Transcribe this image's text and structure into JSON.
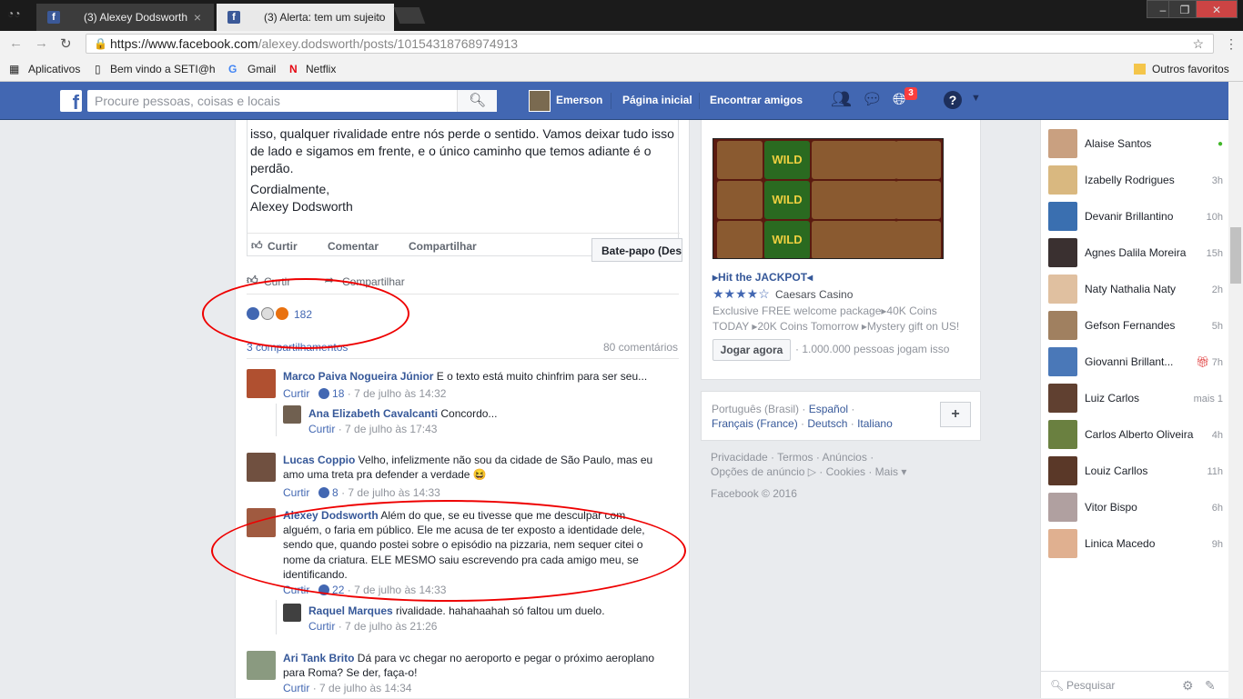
{
  "browser": {
    "tabs": [
      {
        "title": "(3) Alexey Dodsworth",
        "close": "×"
      },
      {
        "title": "(3) Alerta: tem um sujeito",
        "close": "×"
      }
    ],
    "url_host": "https://www.facebook.com",
    "url_path": "/alexey.dodsworth/posts/10154318768974913",
    "bookmarks": [
      "Aplicativos",
      "Bem vindo a SETI@ho",
      "Gmail",
      "Netflix"
    ],
    "other_bookmarks": "Outros favoritos"
  },
  "fb_header": {
    "logo": "f",
    "search_placeholder": "Procure pessoas, coisas e locais",
    "user": "Emerson",
    "home": "Página inicial",
    "find_friends": "Encontrar amigos",
    "notif_count": "3",
    "help": "?"
  },
  "post": {
    "text_lines": [
      "isso, qualquer rivalidade entre nós perde o sentido. Vamos deixar tudo isso",
      "de lado e sigamos em frente, e o único caminho que temos adiante é o",
      "perdão."
    ],
    "sign1": "Cordialmente,",
    "sign2": "Alexey Dodsworth",
    "inner_actions": {
      "like": "Curtir",
      "comment": "Comentar",
      "share": "Compartilhar"
    },
    "chat_tab": "Bate-papo (Des",
    "actions": {
      "like": "Curtir",
      "share": "Compartilhar"
    },
    "reactions_count": "182",
    "shares": "3 compartilhamentos",
    "comments_count": "80 comentários"
  },
  "comments": [
    {
      "name": "Marco Paiva Nogueira Júnior",
      "text": " E o texto está muito chinfrim para ser seu...",
      "like": "Curtir",
      "likes": "18",
      "date": "· 7 de julho às 14:32"
    },
    {
      "name": "Ana Elizabeth Cavalcanti",
      "text": " Concordo...",
      "like": "Curtir",
      "date": "· 7 de julho às 17:43"
    },
    {
      "name": "Lucas Coppio",
      "text": " Velho, infelizmente não sou da cidade de São Paulo, mas eu amo uma treta pra defender a verdade 😆",
      "like": "Curtir",
      "likes": "8",
      "date": "· 7 de julho às 14:33"
    },
    {
      "name": "Alexey Dodsworth",
      "text": " Além do que, se eu tivesse que me desculpar com alguém, o faria em público. Ele me acusa de ter exposto a identidade dele, sendo que, quando postei sobre o episódio na pizzaria, nem sequer citei o nome da criatura. ELE MESMO saiu escrevendo pra cada amigo meu, se identificando.",
      "like": "Curtir",
      "likes": "22",
      "date": "· 7 de julho às 14:33"
    },
    {
      "name": "Raquel Marques",
      "text": " rivalidade. hahahaahah só faltou um duelo.",
      "like": "Curtir",
      "date": "· 7 de julho às 21:26"
    },
    {
      "name": "Ari Tank Brito",
      "text": " Dá para vc chegar no aeroporto e pegar o próximo aeroplano para Roma? Se der, faça-o!",
      "like": "Curtir",
      "date": "· 7 de julho às 14:34"
    }
  ],
  "ad": {
    "wild": "WILD",
    "headline": "▸Hit the JACKPOT◂",
    "stars": "★★★★☆",
    "advertiser": "Caesars Casino",
    "line1": "Exclusive FREE welcome package▸40K Coins",
    "line2": "TODAY ▸20K Coins Tomorrow ▸Mystery gift on US!",
    "button": "Jogar agora",
    "players": "· 1.000.000 pessoas jogam isso"
  },
  "languages": {
    "current": "Português (Brasil) · ",
    "l1": "Español",
    "l2": "Français (France)",
    "l3": "Deutsch",
    "l4": "Italiano",
    "add": "+"
  },
  "footer": {
    "links1": "Privacidade · Termos · Anúncios ·",
    "links2": "Opções de anúncio ▷ · Cookies · Mais ▾",
    "copyright": "Facebook © 2016"
  },
  "chat": {
    "friends": [
      {
        "name": "Alaise Santos",
        "status": "●",
        "color": "#c9a080"
      },
      {
        "name": "Izabelly Rodrigues",
        "status": "3h",
        "color": "#d9b880"
      },
      {
        "name": "Devanir Brillantino",
        "status": "10h",
        "color": "#3a6fb0"
      },
      {
        "name": "Agnes Dalila Moreira",
        "status": "15h",
        "color": "#3a3030"
      },
      {
        "name": "Naty Nathalia Naty",
        "status": "2h",
        "color": "#e0c0a0"
      },
      {
        "name": "Gefson Fernandes",
        "status": "5h",
        "color": "#a08060"
      },
      {
        "name": "Giovanni Brillant...",
        "status": "7h",
        "color": "#4a78b8"
      },
      {
        "name": "Luiz Carlos",
        "status": "mais 1",
        "color": "#604030"
      },
      {
        "name": "Carlos Alberto Oliveira",
        "status": "4h",
        "color": "#6a8040"
      },
      {
        "name": "Louiz Carllos",
        "status": "11h",
        "color": "#5a3828"
      },
      {
        "name": "Vitor Bispo",
        "status": "6h",
        "color": "#b0a0a0"
      },
      {
        "name": "Linica Macedo",
        "status": "9h",
        "color": "#e0b090"
      }
    ],
    "search_placeholder": "Pesquisar"
  }
}
